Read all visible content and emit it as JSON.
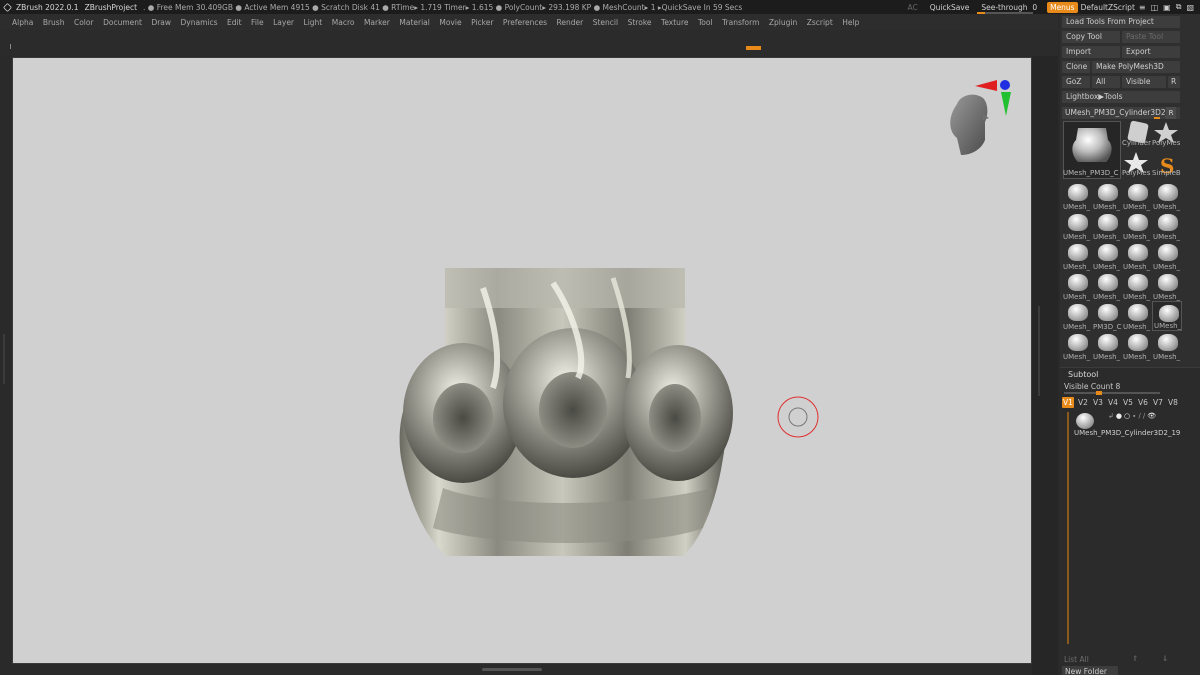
{
  "titlebar": {
    "app": "ZBrush 2022.0.1",
    "project": "ZBrushProject",
    "stats": ". ● Free Mem 30.409GB ● Active Mem 4915 ● Scratch Disk 41 ●  RTime▸ 1.719 Timer▸ 1.615 ● PolyCount▸ 293.198 KP  ● MeshCount▸ 1   ▸QuickSave In 59 Secs",
    "ac": "AC",
    "quicksave": "QuickSave",
    "seethrough": "See-through",
    "seethrough_value": "0",
    "menus": "Menus",
    "default_zscript": "DefaultZScript"
  },
  "menubar": {
    "items": [
      "Alpha",
      "Brush",
      "Color",
      "Document",
      "Draw",
      "Dynamics",
      "Edit",
      "File",
      "Layer",
      "Light",
      "Macro",
      "Marker",
      "Material",
      "Movie",
      "Picker",
      "Preferences",
      "Render",
      "Stencil",
      "Stroke",
      "Texture",
      "Tool",
      "Transform",
      "Zplugin",
      "Zscript",
      "Help"
    ]
  },
  "tool_panel": {
    "load_tools": "Load Tools From Project",
    "copy_tool": "Copy Tool",
    "paste_tool": "Paste Tool",
    "import": "Import",
    "export": "Export",
    "clone": "Clone",
    "make_polymesh": "Make PolyMesh3D",
    "goz": "GoZ",
    "all": "All",
    "visible": "Visible",
    "r": "R",
    "lightbox_tools": "Lightbox▶Tools",
    "current_tool": "UMesh_PM3D_Cylinder3D2_1",
    "current_thumb_label": "UMesh_PM3D_C",
    "side_tools": [
      "Cylinder",
      "PolyMes",
      "PolyMes",
      "SimpleB"
    ],
    "grid_labels": [
      "UMesh_",
      "UMesh_",
      "UMesh_",
      "UMesh_",
      "UMesh_",
      "UMesh_",
      "UMesh_",
      "UMesh_",
      "UMesh_",
      "UMesh_",
      "UMesh_",
      "UMesh_",
      "UMesh_",
      "UMesh_",
      "UMesh_",
      "UMesh_",
      "UMesh_",
      "PM3D_C",
      "UMesh_",
      "UMesh_",
      "UMesh_",
      "UMesh_",
      "UMesh_",
      "UMesh_"
    ]
  },
  "subtool": {
    "title": "Subtool",
    "visible_count_label": "Visible Count 8",
    "visible_count": 8,
    "tabs": [
      "V1",
      "V2",
      "V3",
      "V4",
      "V5",
      "V6",
      "V7",
      "V8"
    ],
    "active_tab": "V1",
    "item_name": "UMesh_PM3D_Cylinder3D2_19",
    "list_all": "List All",
    "new_folder": "New Folder"
  }
}
